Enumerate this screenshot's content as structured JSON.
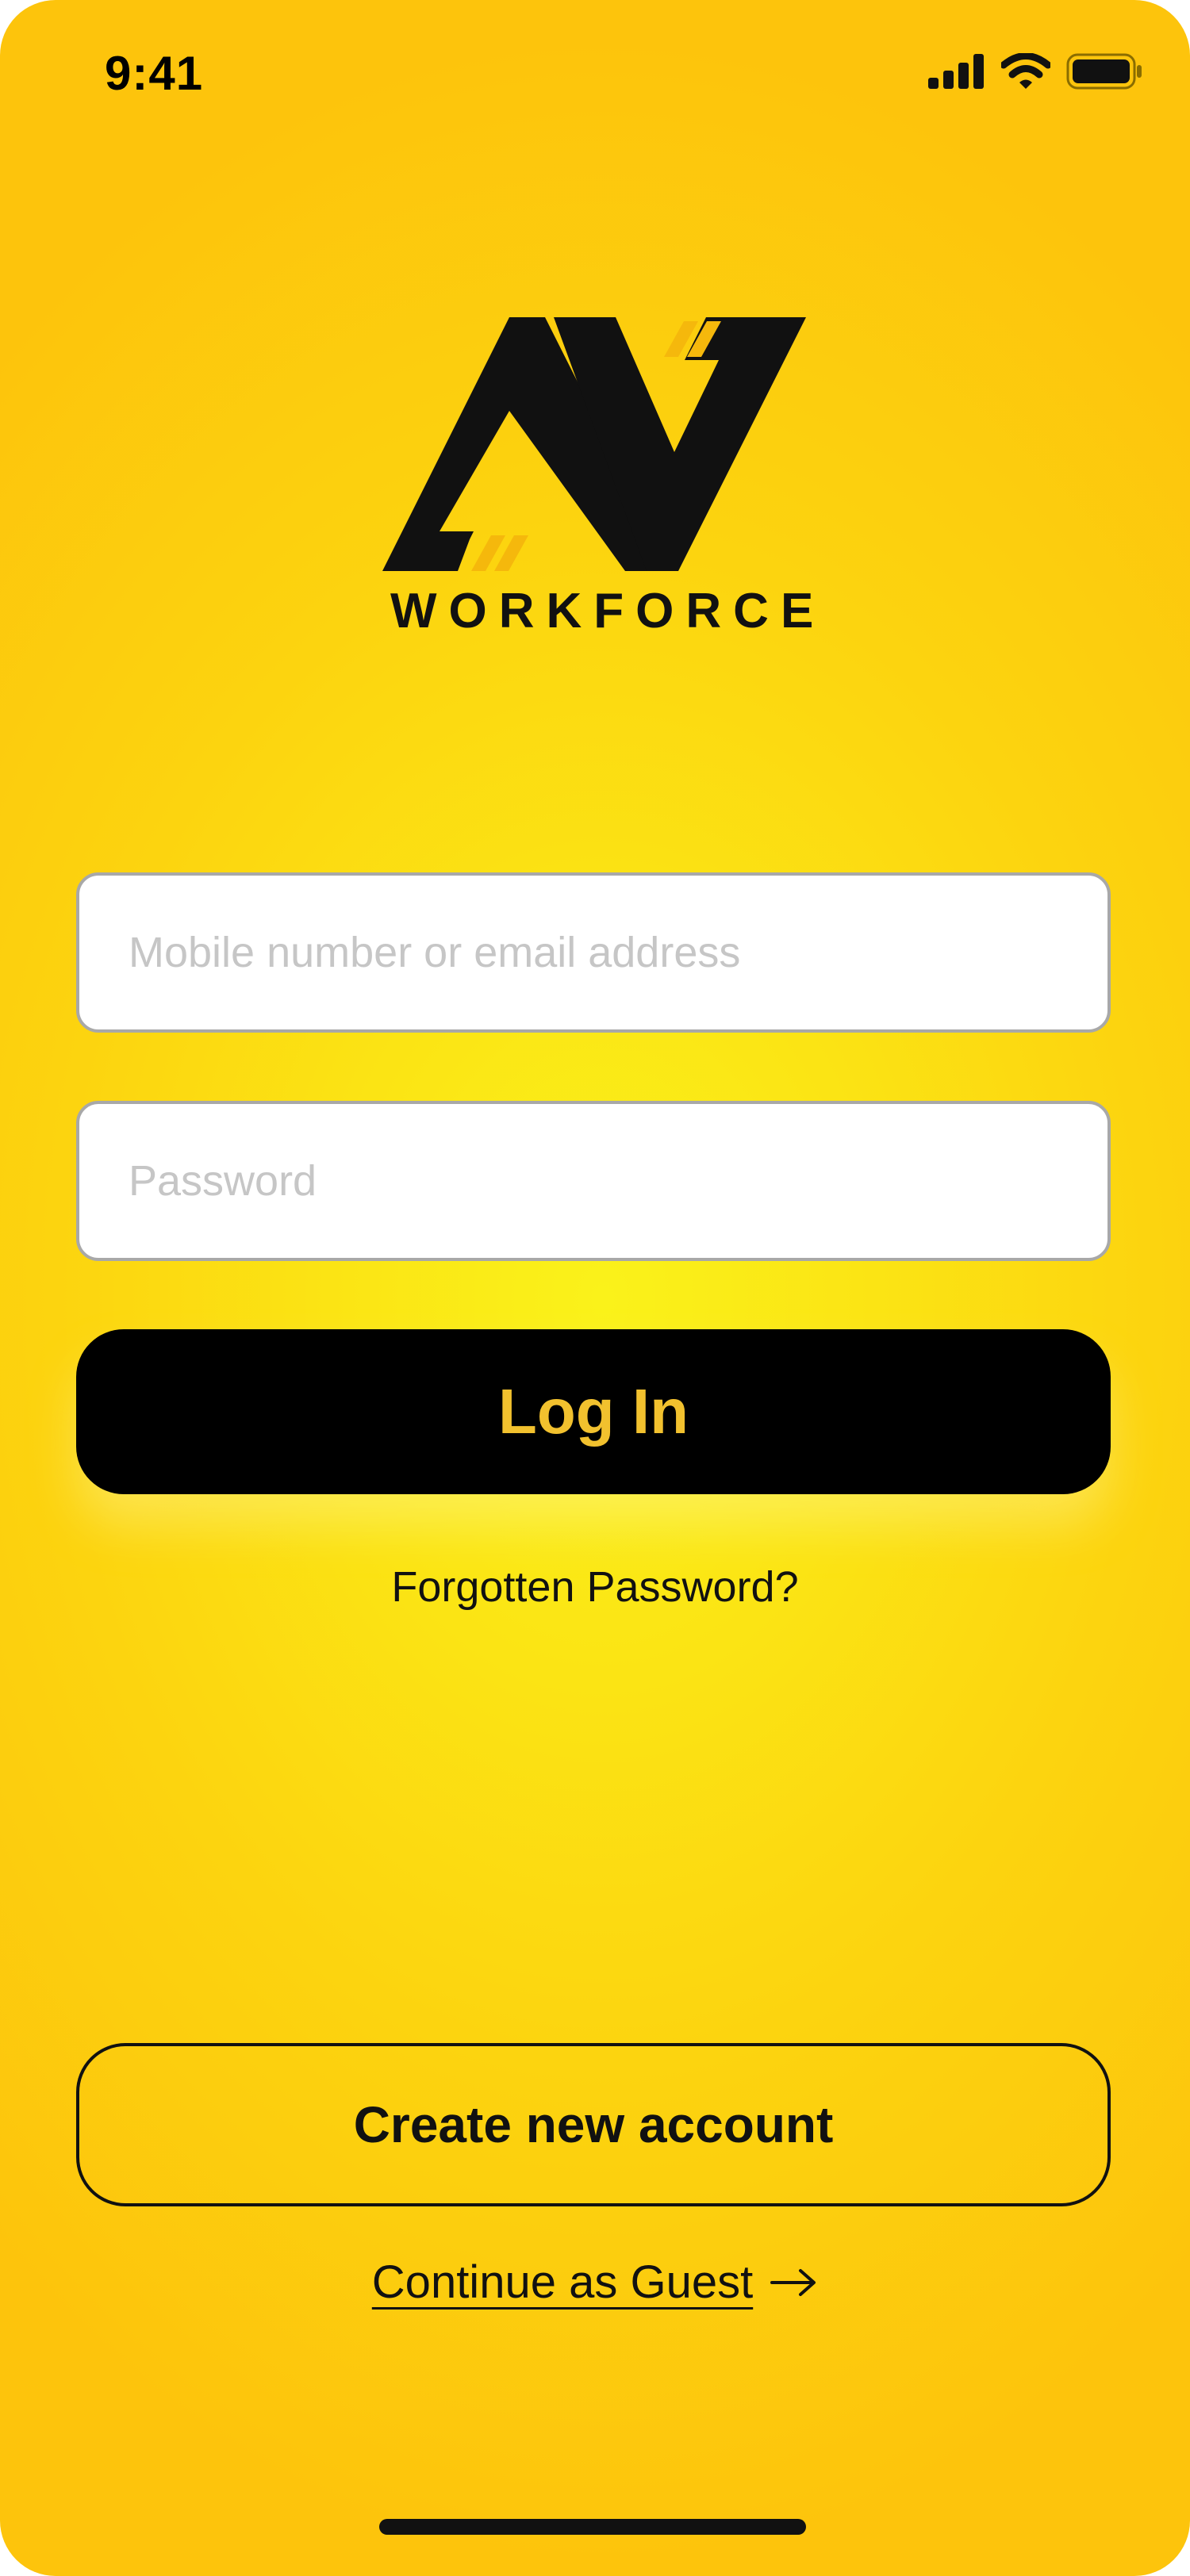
{
  "status_bar": {
    "time": "9:41",
    "icons": [
      "signal-icon",
      "wifi-icon",
      "battery-icon"
    ]
  },
  "brand": {
    "name": "WORKFORCE",
    "logo_icon": "av-monogram-logo",
    "logo_accent": "#f5b80c"
  },
  "login_form": {
    "identifier_placeholder": "Mobile number or email address",
    "password_placeholder": "Password",
    "login_label": "Log In",
    "forgot_label": "Forgotten Password?"
  },
  "create_account": {
    "label": "Create new account"
  },
  "guest": {
    "label": "Continue as Guest",
    "icon": "arrow-right-icon"
  },
  "colors": {
    "background": "#fbe414",
    "button_bg": "#000000",
    "button_text": "#f2c12e"
  }
}
